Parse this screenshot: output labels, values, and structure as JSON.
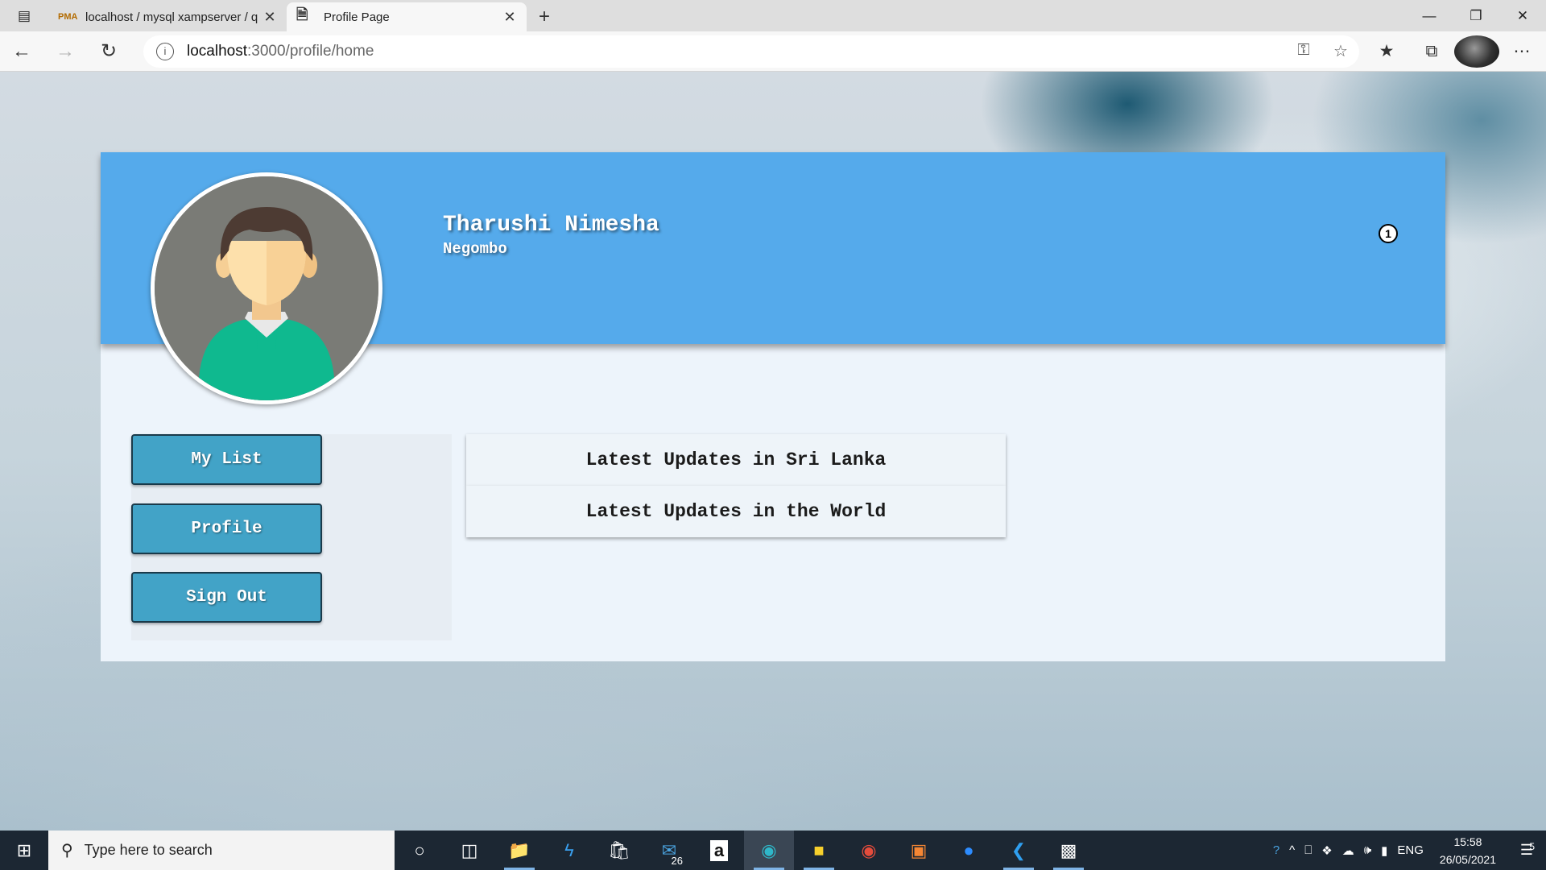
{
  "browser": {
    "tabs": [
      {
        "title": "localhost / mysql xampserver / q",
        "favicon": "PMA",
        "active": false
      },
      {
        "title": "Profile Page",
        "favicon": "page-icon",
        "active": true
      }
    ],
    "address": {
      "host": "localhost",
      "path": ":3000/profile/home"
    }
  },
  "profile": {
    "name": "Tharushi Nimesha",
    "city": "Negombo",
    "notification_count": "1"
  },
  "sidebar": {
    "items": [
      {
        "label": "My List"
      },
      {
        "label": "Profile"
      },
      {
        "label": "Sign Out"
      }
    ]
  },
  "updates": [
    {
      "label": "Latest Updates in Sri Lanka"
    },
    {
      "label": "Latest Updates in the World"
    }
  ],
  "taskbar": {
    "search_placeholder": "Type here to search",
    "mail_badge": "26",
    "lang": "ENG",
    "time": "15:58",
    "date": "26/05/2021",
    "notification_badge": "5"
  },
  "colors": {
    "banner": "#55aaeb",
    "button": "#42a3c7",
    "card": "#edf4fb"
  }
}
